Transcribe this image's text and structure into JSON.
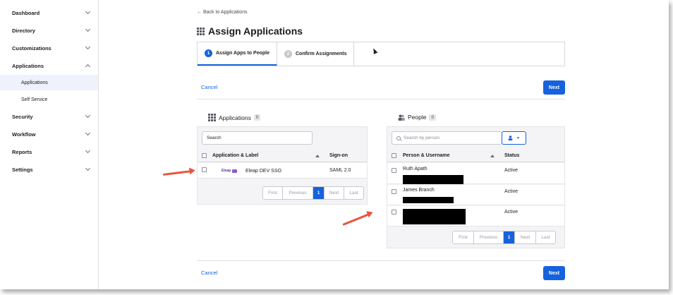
{
  "sidebar": {
    "items": [
      {
        "label": "Dashboard"
      },
      {
        "label": "Directory"
      },
      {
        "label": "Customizations"
      },
      {
        "label": "Applications"
      },
      {
        "label": "Security"
      },
      {
        "label": "Workflow"
      },
      {
        "label": "Reports"
      },
      {
        "label": "Settings"
      }
    ],
    "sub_items": [
      {
        "label": "Applications"
      },
      {
        "label": "Self Service"
      }
    ]
  },
  "header": {
    "back_link": "← Back to Applications",
    "title": "Assign Applications"
  },
  "steps": [
    {
      "number": "1",
      "label": "Assign Apps to People"
    },
    {
      "number": "2",
      "label": "Confirm Assignments"
    }
  ],
  "actions": {
    "cancel_label": "Cancel",
    "next_label": "Next"
  },
  "applications_panel": {
    "title": "Applications",
    "count": "0",
    "search_value": "Search",
    "col_app": "Application & Label",
    "col_signon": "Sign-on",
    "rows": [
      {
        "logo_text": "Eleap",
        "name": "Eleap DEV SSO",
        "signon": "SAML 2.0"
      }
    ],
    "pager": {
      "first": "First",
      "previous": "Previous",
      "current": "1",
      "next": "Next",
      "last": "Last"
    }
  },
  "people_panel": {
    "title": "People",
    "count": "0",
    "search_placeholder": "Search by person",
    "col_person": "Person & Username",
    "col_status": "Status",
    "rows": [
      {
        "name": "Ruth Apath",
        "status": "Active"
      },
      {
        "name": "James Branch",
        "status": "Active"
      },
      {
        "name": "",
        "status": "Active"
      }
    ],
    "pager": {
      "first": "First",
      "previous": "Previous",
      "current": "1",
      "next": "Next",
      "last": "Last"
    }
  },
  "colors": {
    "accent": "#1662dd",
    "annotation_arrow": "#e8553f"
  }
}
